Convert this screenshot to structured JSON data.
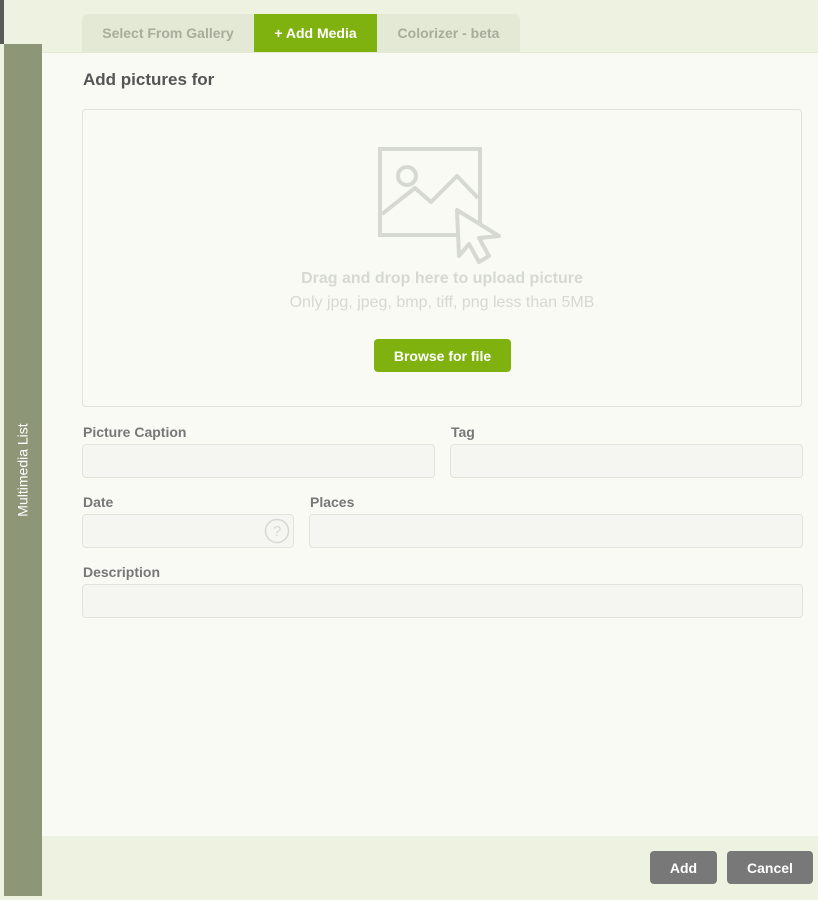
{
  "sidebar": {
    "label": "Multimedia List"
  },
  "tabs": [
    {
      "label": "Select From Gallery",
      "active": false
    },
    {
      "label": "+ Add Media",
      "active": true
    },
    {
      "label": "Colorizer - beta",
      "active": false
    }
  ],
  "title": "Add pictures for",
  "dropzone": {
    "main_text": "Drag and drop here to upload picture",
    "sub_text": "Only jpg, jpeg, bmp, tiff, png less than 5MB",
    "browse_label": "Browse for file",
    "icon": "image-upload-icon"
  },
  "form": {
    "caption_label": "Picture Caption",
    "caption_value": "",
    "tag_label": "Tag",
    "tag_value": "",
    "date_label": "Date",
    "date_value": "",
    "places_label": "Places",
    "places_value": "",
    "description_label": "Description",
    "description_value": ""
  },
  "footer": {
    "add_label": "Add",
    "cancel_label": "Cancel"
  },
  "colors": {
    "accent": "#7fb20f",
    "sidebar": "#8d9778",
    "button_gray": "#787878",
    "panel": "#eef3e1"
  }
}
